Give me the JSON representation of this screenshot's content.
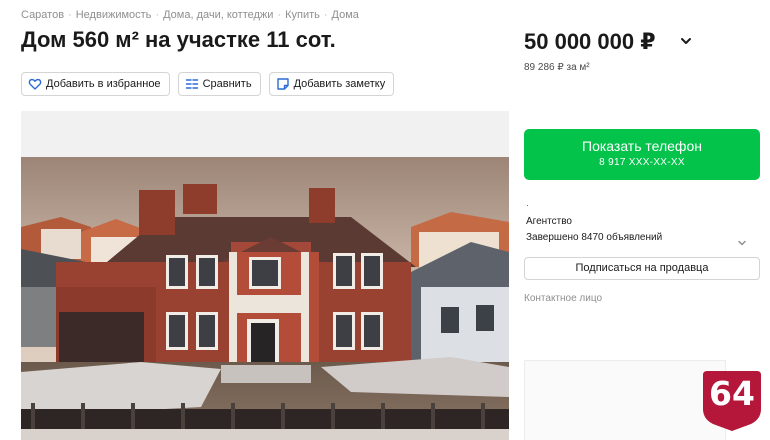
{
  "breadcrumbs": [
    "Саратов",
    "Недвижимость",
    "Дома, дачи, коттеджи",
    "Купить",
    "Дома"
  ],
  "listing": {
    "title": "Дом 560 м² на участке 11 сот.",
    "price": "50 000 000 ₽",
    "price_per_m2": "89 286 ₽ за м²"
  },
  "toolbar": {
    "favorite_label": "Добавить в избранное",
    "compare_label": "Сравнить",
    "note_label": "Добавить заметку"
  },
  "seller": {
    "phone_button_label": "Показать телефон",
    "phone_masked": "8 917 XXX-XX-XX",
    "name": "·",
    "type": "Агентство",
    "completed": "Завершено 8470 объявлений",
    "subscribe_label": "Подписаться на продавца",
    "contact_label": "Контактное лицо"
  },
  "badge": {
    "text": "64",
    "color": "#b5173a"
  },
  "colors": {
    "accent_green": "#04c34b",
    "favorite_icon": "#2c6bd6"
  },
  "icons": [
    "heart-icon",
    "compare-icon",
    "note-icon",
    "chevron-down-icon"
  ]
}
